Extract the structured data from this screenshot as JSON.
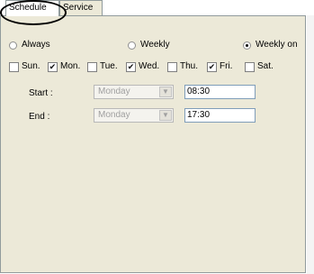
{
  "tabs": [
    {
      "label": "Schedule"
    },
    {
      "label": "Service"
    }
  ],
  "recurrence": {
    "always": "Always",
    "weekly": "Weekly",
    "weekly_on": "Weekly on",
    "selected": "Weekly on"
  },
  "days": [
    {
      "label": "Sun.",
      "checked": false
    },
    {
      "label": "Mon.",
      "checked": true
    },
    {
      "label": "Tue.",
      "checked": false
    },
    {
      "label": "Wed.",
      "checked": true
    },
    {
      "label": "Thu.",
      "checked": false
    },
    {
      "label": "Fri.",
      "checked": true
    },
    {
      "label": "Sat.",
      "checked": false
    }
  ],
  "start": {
    "label": "Start :",
    "day": "Monday",
    "time": "08:30"
  },
  "end": {
    "label": "End :",
    "day": "Monday",
    "time": "17:30"
  }
}
